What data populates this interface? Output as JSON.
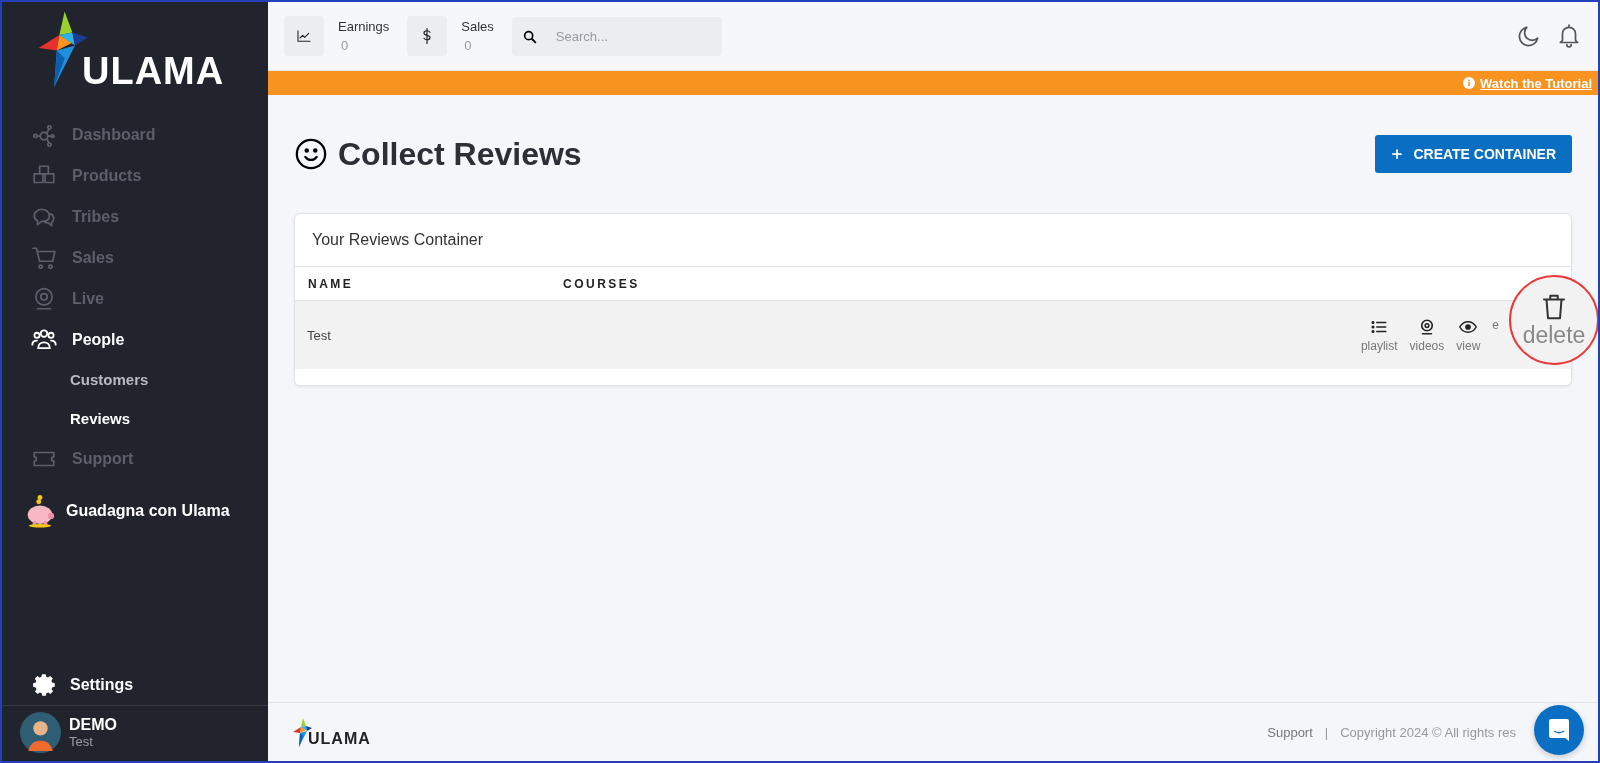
{
  "sidebar": {
    "logo": "ULAMA",
    "items": [
      {
        "label": "Dashboard",
        "kind": "nav",
        "selected": false
      },
      {
        "label": "Products",
        "kind": "nav",
        "selected": false
      },
      {
        "label": "Tribes",
        "kind": "nav",
        "selected": false
      },
      {
        "label": "Sales",
        "kind": "nav",
        "selected": false
      },
      {
        "label": "Live",
        "kind": "nav",
        "selected": false
      },
      {
        "label": "People",
        "kind": "nav",
        "selected": true,
        "children": [
          {
            "label": "Customers",
            "selected": false
          },
          {
            "label": "Reviews",
            "selected": true
          }
        ]
      },
      {
        "label": "Support",
        "kind": "nav",
        "selected": false
      },
      {
        "label": "Guadagna con Ulama",
        "kind": "promo",
        "selected": false
      }
    ],
    "settings": "Settings",
    "user": {
      "name": "DEMO",
      "role": "Test"
    }
  },
  "topbar": {
    "stats": [
      {
        "label": "Earnings",
        "value": "0"
      },
      {
        "label": "Sales",
        "value": "0"
      }
    ],
    "search": {
      "placeholder": "Search..."
    }
  },
  "banner": {
    "link": "Watch the Tutorial"
  },
  "page": {
    "title": "Collect Reviews",
    "create_button": "CREATE CONTAINER",
    "card": {
      "title": "Your Reviews Container",
      "columns": [
        "NAME",
        "COURSES"
      ],
      "rows": [
        {
          "name": "Test",
          "actions": [
            "playlist",
            "videos",
            "view",
            "e"
          ]
        }
      ]
    },
    "callout": {
      "label": "delete"
    }
  },
  "footer": {
    "logo": "ULAMA",
    "link": "Support",
    "separator": "|",
    "copyright": "Copyright 2024 © All rights res"
  }
}
